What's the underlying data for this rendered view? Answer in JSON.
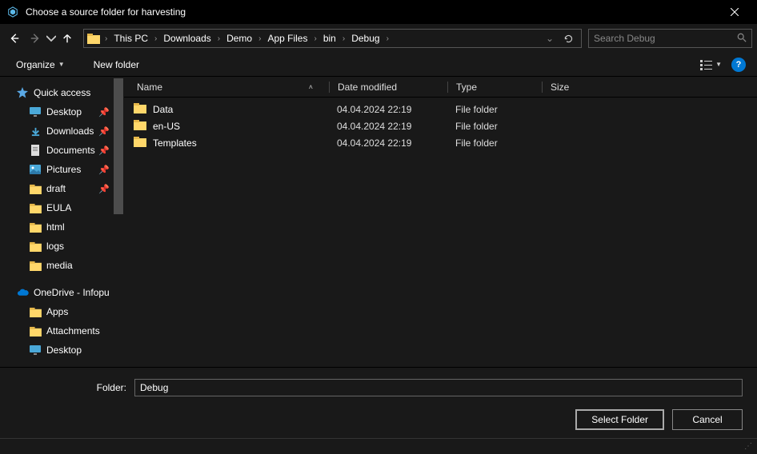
{
  "window": {
    "title": "Choose a source folder for harvesting"
  },
  "breadcrumb": {
    "items": [
      "This PC",
      "Downloads",
      "Demo",
      "App Files",
      "bin",
      "Debug"
    ]
  },
  "search": {
    "placeholder": "Search Debug"
  },
  "toolbar": {
    "organize": "Organize",
    "new_folder": "New folder"
  },
  "sidebar": {
    "quick_access": "Quick access",
    "pinned": [
      {
        "label": "Desktop",
        "icon": "desktop"
      },
      {
        "label": "Downloads",
        "icon": "downloads"
      },
      {
        "label": "Documents",
        "icon": "documents"
      },
      {
        "label": "Pictures",
        "icon": "pictures"
      },
      {
        "label": "draft",
        "icon": "folder"
      }
    ],
    "recent": [
      {
        "label": "EULA"
      },
      {
        "label": "html"
      },
      {
        "label": "logs"
      },
      {
        "label": "media"
      }
    ],
    "onedrive": {
      "label": "OneDrive - Infopu",
      "items": [
        {
          "label": "Apps"
        },
        {
          "label": "Attachments"
        },
        {
          "label": "Desktop"
        }
      ]
    }
  },
  "columns": {
    "name": "Name",
    "date": "Date modified",
    "type": "Type",
    "size": "Size"
  },
  "files": [
    {
      "name": "Data",
      "date": "04.04.2024 22:19",
      "type": "File folder",
      "size": ""
    },
    {
      "name": "en-US",
      "date": "04.04.2024 22:19",
      "type": "File folder",
      "size": ""
    },
    {
      "name": "Templates",
      "date": "04.04.2024 22:19",
      "type": "File folder",
      "size": ""
    }
  ],
  "footer": {
    "folder_label": "Folder:",
    "folder_value": "Debug",
    "select": "Select Folder",
    "cancel": "Cancel"
  }
}
